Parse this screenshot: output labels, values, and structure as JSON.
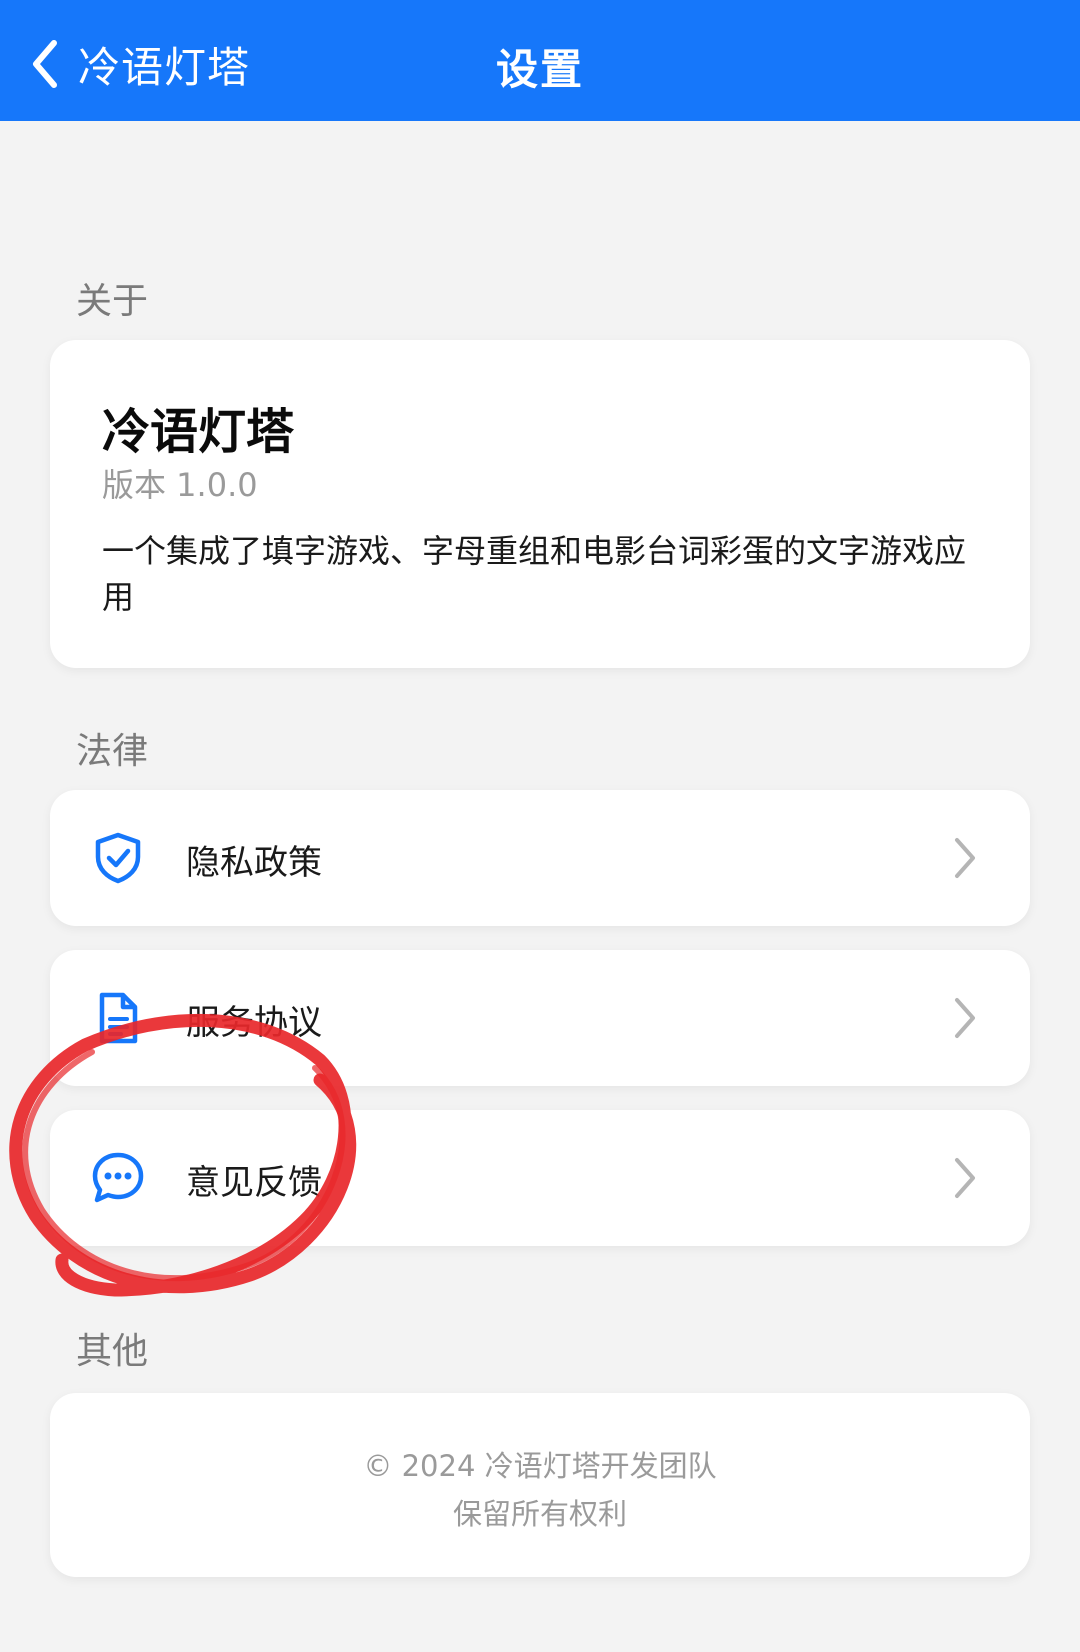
{
  "header": {
    "back_label": "冷语灯塔",
    "title": "设置",
    "background_color": "#1677fa"
  },
  "sections": {
    "about": {
      "label": "关于",
      "app_name": "冷语灯塔",
      "version": "版本 1.0.0",
      "description": "一个集成了填字游戏、字母重组和电影台词彩蛋的文字游戏应用"
    },
    "legal": {
      "label": "法律",
      "items": [
        {
          "label": "隐私政策",
          "icon": "shield-check-icon"
        },
        {
          "label": "服务协议",
          "icon": "document-icon"
        },
        {
          "label": "意见反馈",
          "icon": "chat-bubble-icon"
        }
      ]
    },
    "other": {
      "label": "其他",
      "copyright": "© 2024 冷语灯塔开发团队",
      "rights": "保留所有权利"
    }
  },
  "colors": {
    "accent": "#1677fa",
    "annotation": "#e8272a"
  }
}
